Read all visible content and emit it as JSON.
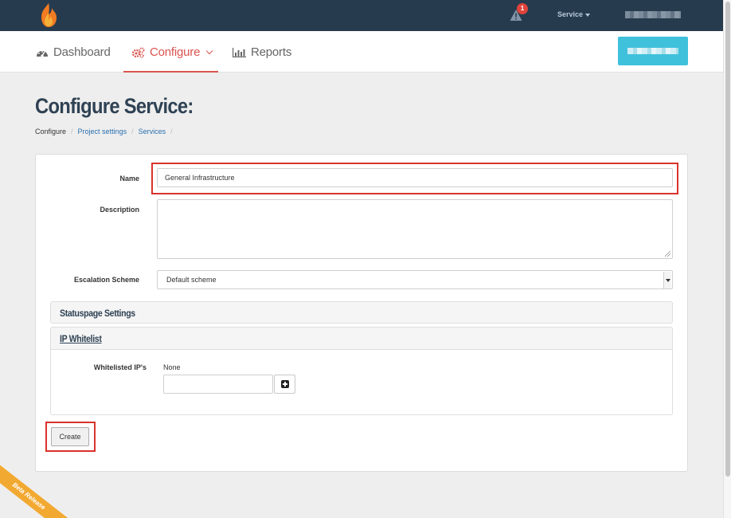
{
  "topbar": {
    "alert_count": "1",
    "service_menu_label": "Service"
  },
  "nav": {
    "dashboard_label": "Dashboard",
    "configure_label": "Configure",
    "reports_label": "Reports"
  },
  "page": {
    "title": "Configure Service:",
    "breadcrumb": [
      "Configure",
      "Project settings",
      "Services"
    ]
  },
  "form": {
    "name_label": "Name",
    "name_value": "General Infrastructure",
    "description_label": "Description",
    "description_value": "",
    "escalation_label": "Escalation Scheme",
    "escalation_value": "Default scheme",
    "statuspage_heading": "Statuspage Settings",
    "ip_whitelist_heading": "IP Whitelist",
    "whitelisted_label": "Whitelisted IP's",
    "whitelisted_value": "None",
    "ip_input_value": "",
    "create_label": "Create"
  },
  "beta_ribbon": "Beta Release",
  "colors": {
    "topbar": "#263b4e",
    "accent_red": "#d9534f",
    "cyan_button": "#3fc1dc",
    "highlight_red": "#d9332b"
  },
  "icons": [
    "flame-logo-icon",
    "warning-icon",
    "dashboard-gauge-icon",
    "gears-icon",
    "bar-chart-icon",
    "plus-square-icon",
    "chevron-down-icon"
  ]
}
